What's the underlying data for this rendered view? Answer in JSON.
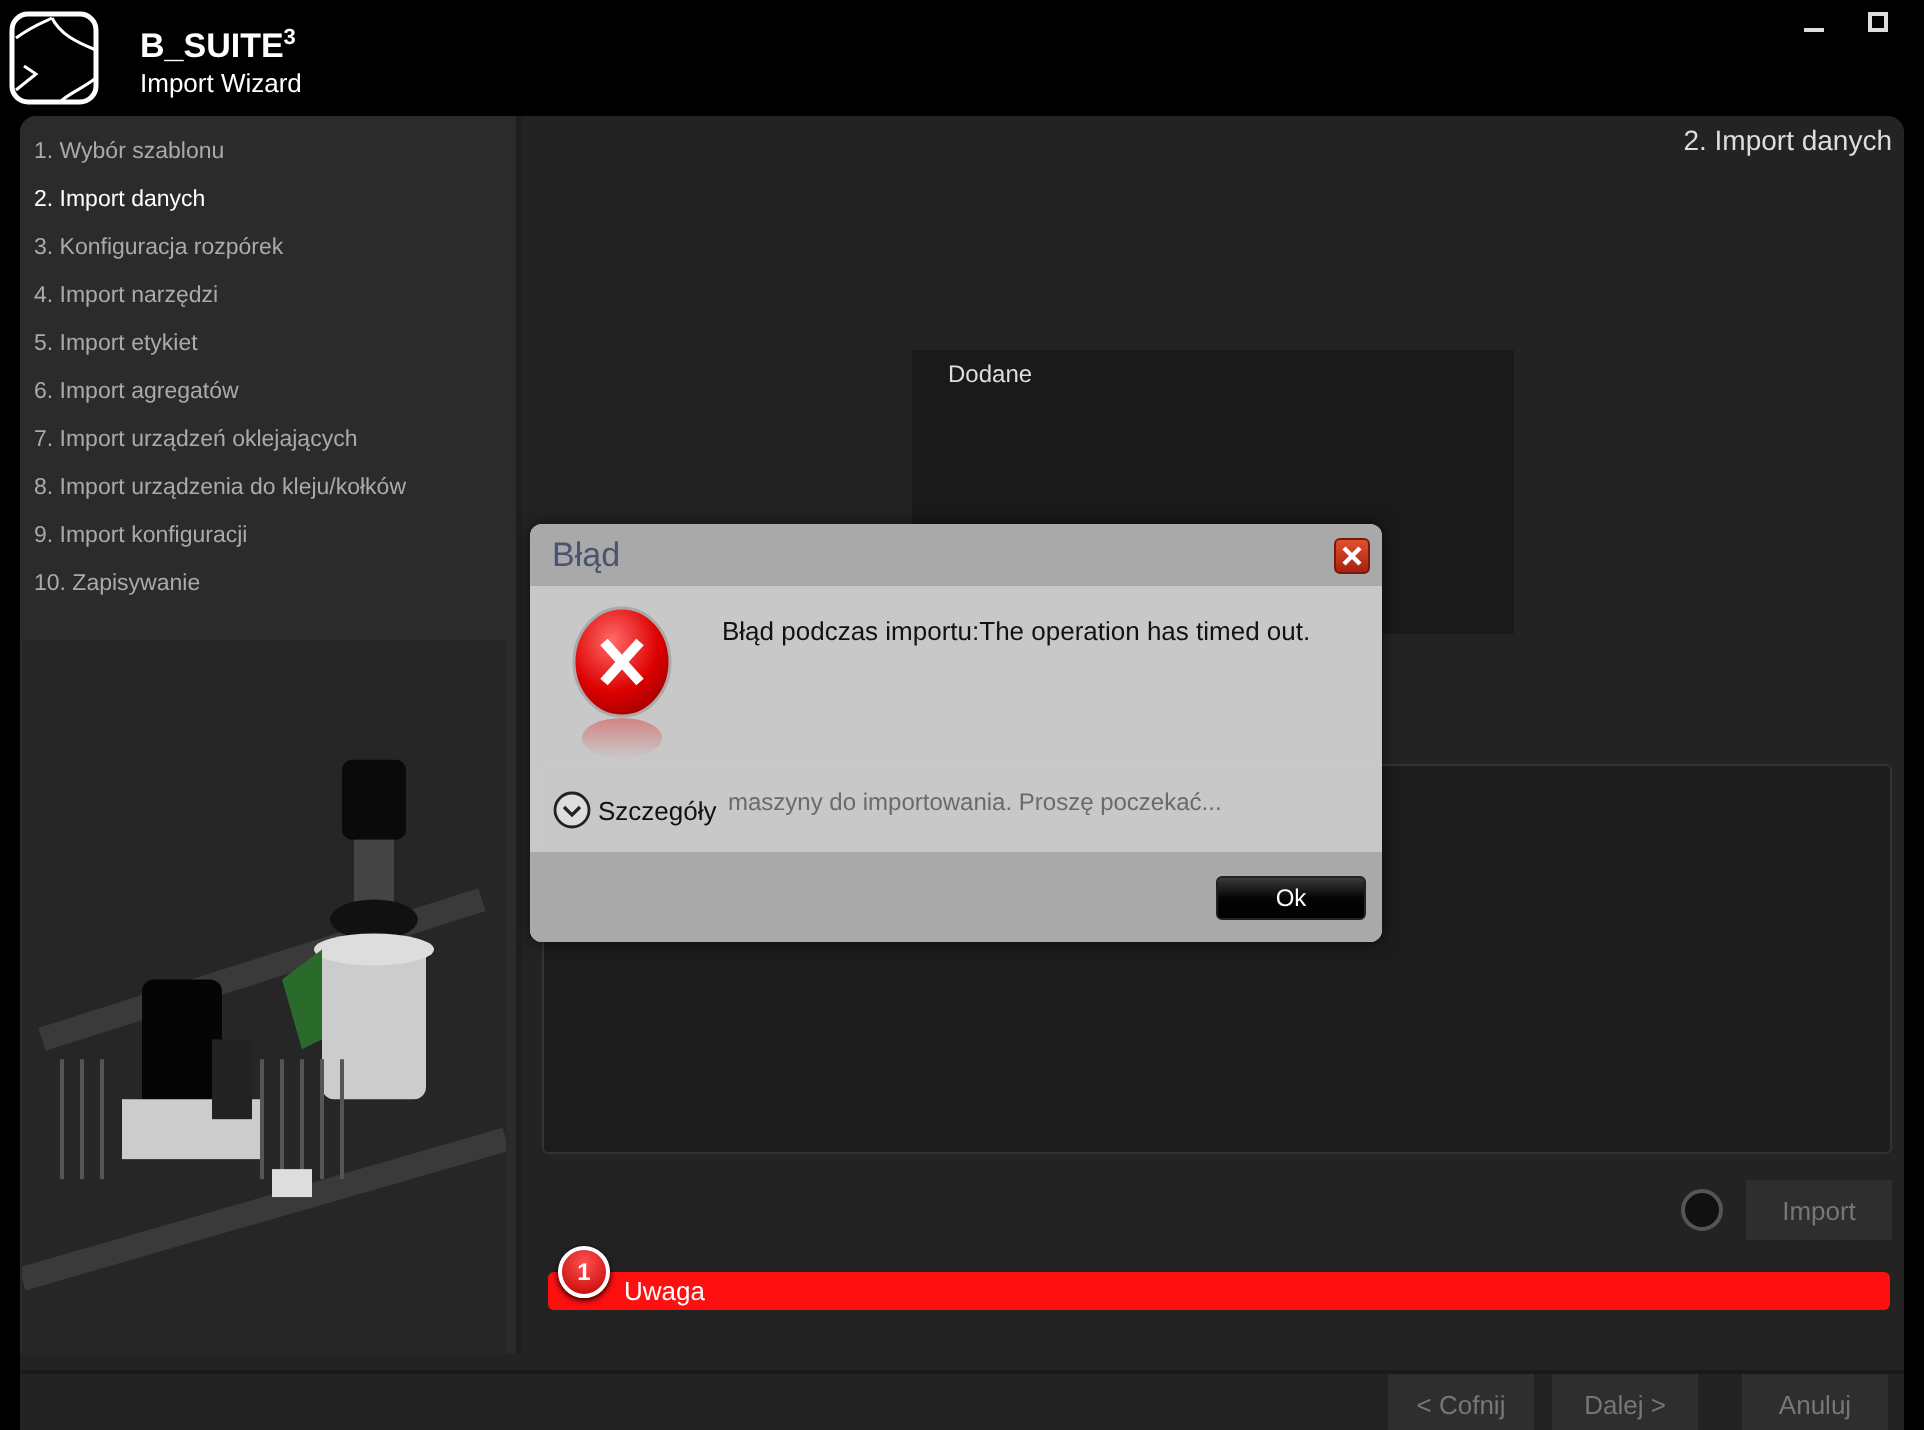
{
  "window": {
    "title": "B_SUITE$^{3}$",
    "subtitle": "Import Wizard"
  },
  "steps": [
    {
      "label": "1. Wybór szablonu",
      "selected": false
    },
    {
      "label": "2. Import danych",
      "selected": true
    },
    {
      "label": "3. Konfiguracja rozpórek",
      "selected": false
    },
    {
      "label": "4. Import narzędzi",
      "selected": false
    },
    {
      "label": "5. Import etykiet",
      "selected": false
    },
    {
      "label": "6. Import agregatów",
      "selected": false
    },
    {
      "label": "7. Import urządzeń oklejających",
      "selected": false
    },
    {
      "label": "8. Import urządzenia do kleju/kołków",
      "selected": false
    },
    {
      "label": "9. Import konfiguracji",
      "selected": false
    },
    {
      "label": "10. Zapisywanie",
      "selected": false
    }
  ],
  "page_title": "2. Import danych",
  "added_list": {
    "header": "Dodane"
  },
  "log": {
    "text": "maszyny do importowania. Proszę poczekać..."
  },
  "import_button": "Import",
  "warning": {
    "count": "1",
    "label": "Uwaga"
  },
  "nav_buttons": [
    "< Cofnij",
    "Dalej >",
    "Anuluj"
  ],
  "dialog": {
    "title": "Błąd",
    "message": "Błąd podczas importu:The operation has timed out.",
    "details": {
      "label": "Szczegóły",
      "expanded": false
    },
    "ok": "Ok"
  }
}
